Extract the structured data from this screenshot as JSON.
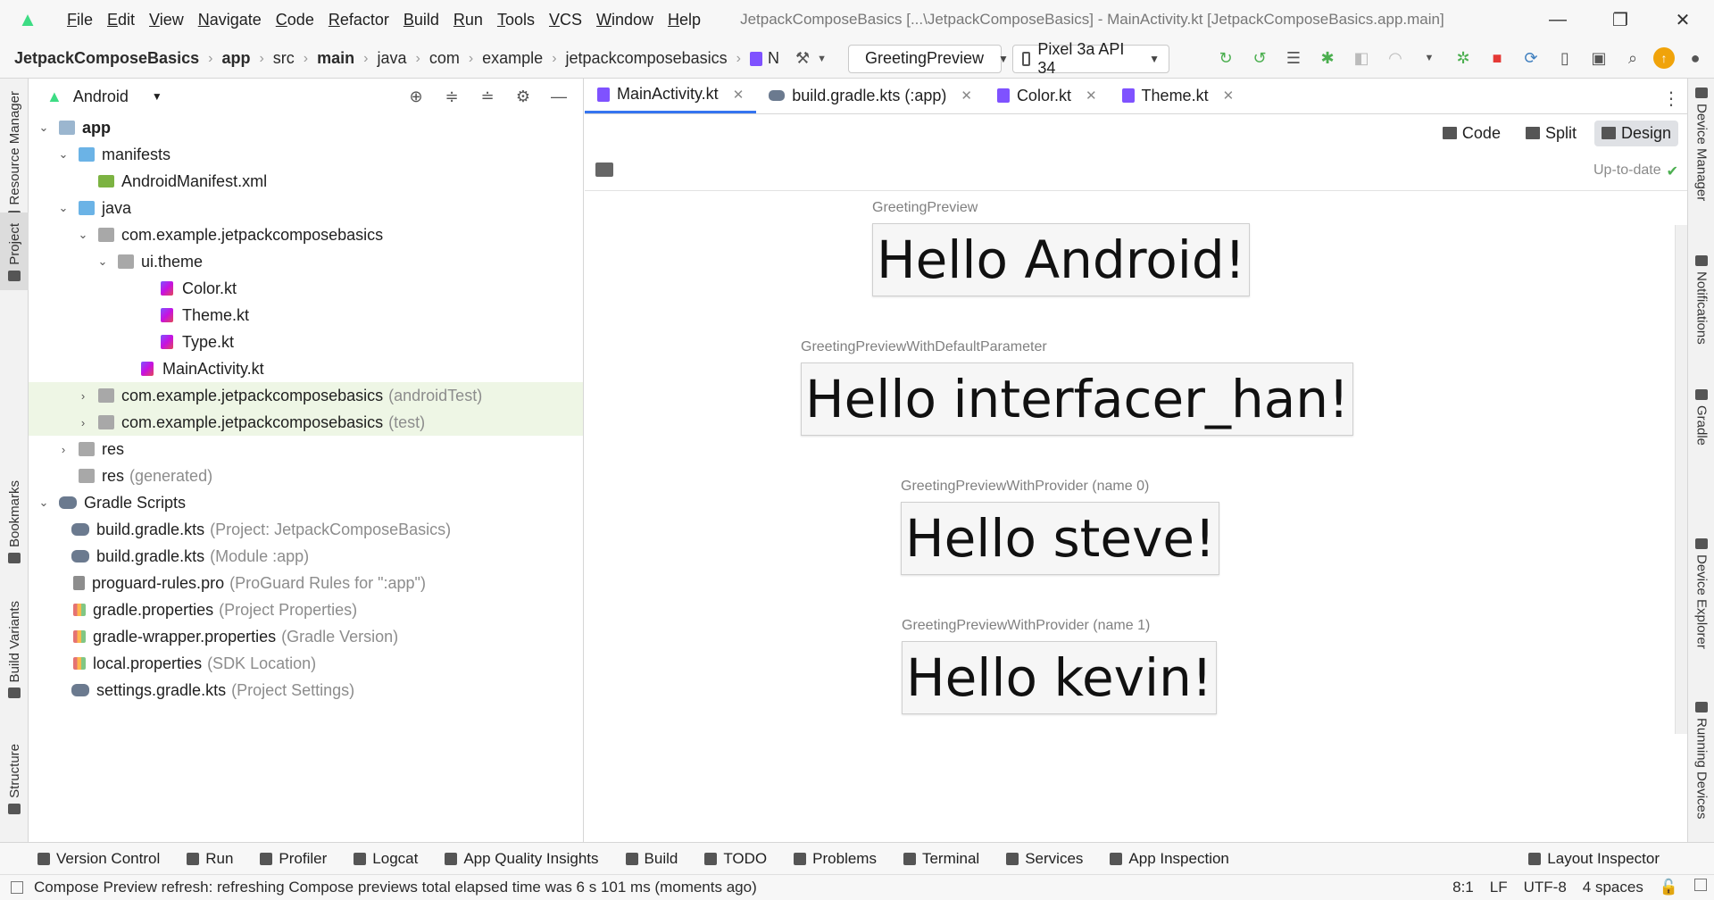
{
  "menubar": {
    "items": [
      "File",
      "Edit",
      "View",
      "Navigate",
      "Code",
      "Refactor",
      "Build",
      "Run",
      "Tools",
      "VCS",
      "Window",
      "Help"
    ],
    "window_title": "JetpackComposeBasics [...\\JetpackComposeBasics] - MainActivity.kt [JetpackComposeBasics.app.main]"
  },
  "breadcrumb": [
    "JetpackComposeBasics",
    "app",
    "src",
    "main",
    "java",
    "com",
    "example",
    "jetpackcomposebasics"
  ],
  "breadcrumb_tail": "N",
  "toolbar": {
    "run_config": "GreetingPreview",
    "device": "Pixel 3a API 34"
  },
  "left_strip": [
    "Resource Manager",
    "Project",
    "Bookmarks",
    "Build Variants",
    "Structure"
  ],
  "right_strip": [
    "Device Manager",
    "Notifications",
    "Gradle",
    "Device Explorer",
    "Running Devices"
  ],
  "project_panel": {
    "view_mode": "Android",
    "tree": [
      {
        "label": "app",
        "hint": "",
        "bold": true
      },
      {
        "label": "manifests",
        "hint": ""
      },
      {
        "label": "AndroidManifest.xml",
        "hint": ""
      },
      {
        "label": "java",
        "hint": ""
      },
      {
        "label": "com.example.jetpackcomposebasics",
        "hint": ""
      },
      {
        "label": "ui.theme",
        "hint": ""
      },
      {
        "label": "Color.kt",
        "hint": ""
      },
      {
        "label": "Theme.kt",
        "hint": ""
      },
      {
        "label": "Type.kt",
        "hint": ""
      },
      {
        "label": "MainActivity.kt",
        "hint": ""
      },
      {
        "label": "com.example.jetpackcomposebasics",
        "hint": "(androidTest)"
      },
      {
        "label": "com.example.jetpackcomposebasics",
        "hint": "(test)"
      },
      {
        "label": "res",
        "hint": ""
      },
      {
        "label": "res",
        "hint": "(generated)"
      },
      {
        "label": "Gradle Scripts",
        "hint": ""
      },
      {
        "label": "build.gradle.kts",
        "hint": "(Project: JetpackComposeBasics)"
      },
      {
        "label": "build.gradle.kts",
        "hint": "(Module :app)"
      },
      {
        "label": "proguard-rules.pro",
        "hint": "(ProGuard Rules for \":app\")"
      },
      {
        "label": "gradle.properties",
        "hint": "(Project Properties)"
      },
      {
        "label": "gradle-wrapper.properties",
        "hint": "(Gradle Version)"
      },
      {
        "label": "local.properties",
        "hint": "(SDK Location)"
      },
      {
        "label": "settings.gradle.kts",
        "hint": "(Project Settings)"
      }
    ]
  },
  "editor": {
    "tabs": [
      "MainActivity.kt",
      "build.gradle.kts (:app)",
      "Color.kt",
      "Theme.kt"
    ],
    "modes": [
      "Code",
      "Split",
      "Design"
    ],
    "status": "Up-to-date",
    "previews": [
      {
        "label": "GreetingPreview",
        "text": "Hello Android!"
      },
      {
        "label": "GreetingPreviewWithDefaultParameter",
        "text": "Hello interfacer_han!"
      },
      {
        "label": "GreetingPreviewWithProvider (name 0)",
        "text": "Hello steve!"
      },
      {
        "label": "GreetingPreviewWithProvider (name 1)",
        "text": "Hello kevin!"
      }
    ]
  },
  "bottom_tabs": [
    "Version Control",
    "Run",
    "Profiler",
    "Logcat",
    "App Quality Insights",
    "Build",
    "TODO",
    "Problems",
    "Terminal",
    "Services",
    "App Inspection"
  ],
  "bottom_right_tab": "Layout Inspector",
  "statusbar": {
    "message": "Compose Preview refresh: refreshing Compose previews total elapsed time was 6 s 101 ms (moments ago)",
    "position": "8:1",
    "line_sep": "LF",
    "encoding": "UTF-8",
    "indent": "4 spaces"
  },
  "colors": {
    "android_green": "#3ddc84",
    "active_tab_underline": "#3574f0",
    "test_highlight": "#eef6e5"
  }
}
